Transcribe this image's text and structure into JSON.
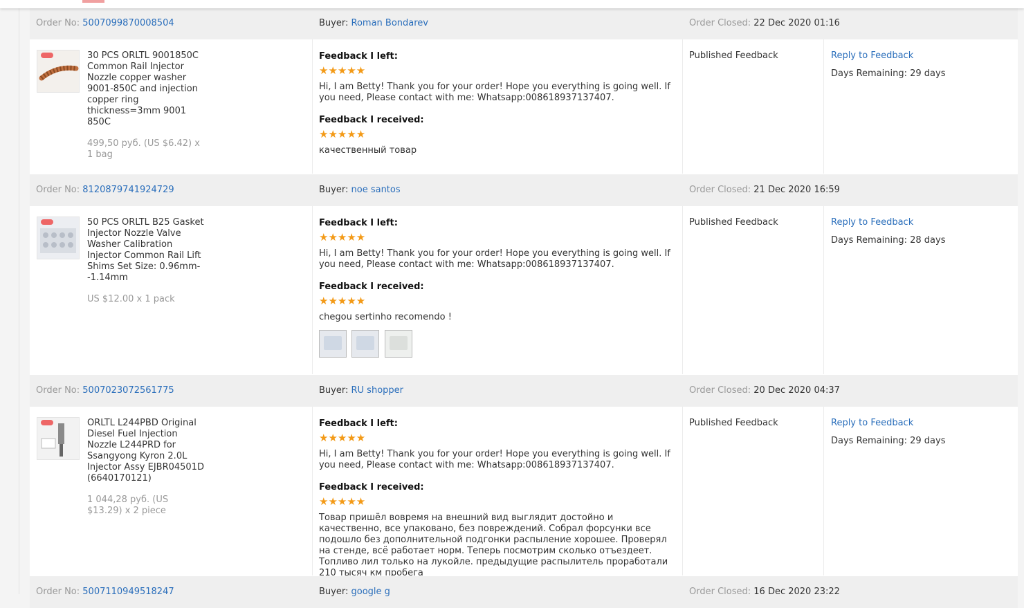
{
  "labels": {
    "order_no": "Order No:",
    "buyer": "Buyer:",
    "order_closed": "Order Closed:",
    "feedback_left": "Feedback I left:",
    "feedback_received": "Feedback I received:",
    "published": "Published Feedback",
    "reply": "Reply to Feedback"
  },
  "colors": {
    "link": "#2a6ebb",
    "star": "#f39a17",
    "header_bg": "#efefef"
  },
  "orders": [
    {
      "order_no": "5007099870008504",
      "buyer": "Roman Bondarev",
      "closed": "22 Dec 2020 01:16",
      "product_name": "30 PCS ORLTL 9001850C Common Rail Injector Nozzle copper washer 9001-850C and injection copper ring thickness=3mm 9001 850C",
      "price": "499,50 руб. (US $6.42) x 1 bag",
      "stars_left": "★★★★★",
      "feedback_left": "Hi, I am Betty! Thank you for your order! Hope you everything is going well. If you need, Please contact with me: Whatsapp:008618937137407.",
      "stars_received": "★★★★★",
      "feedback_received": "качественный товар",
      "days_remaining": "Days Remaining: 29 days"
    },
    {
      "order_no": "8120879741924729",
      "buyer": "noe santos",
      "closed": "21 Dec 2020 16:59",
      "product_name": "50 PCS ORLTL B25 Gasket Injector Nozzle Valve Washer Calibration Injector Common Rail Lift Shims Set Size: 0.96mm--1.14mm",
      "price": "US $12.00 x 1 pack",
      "stars_left": "★★★★★",
      "feedback_left": "Hi, I am Betty! Thank you for your order! Hope you everything is going well. If you need, Please contact with me: Whatsapp:008618937137407.",
      "stars_received": "★★★★★",
      "feedback_received": "chegou sertinho recomendo !",
      "days_remaining": "Days Remaining: 28 days"
    },
    {
      "order_no": "5007023072561775",
      "buyer": "RU shopper",
      "closed": "20 Dec 2020 04:37",
      "product_name": "ORLTL L244PBD Original Diesel Fuel Injection Nozzle L244PRD for Ssangyong Kyron 2.0L Injector Assy EJBR04501D (6640170121)",
      "price": "1 044,28 руб. (US $13.29) x 2 piece",
      "stars_left": "★★★★★",
      "feedback_left": "Hi, I am Betty! Thank you for your order! Hope you everything is going well. If you need, Please contact with me: Whatsapp:008618937137407.",
      "stars_received": "★★★★★",
      "feedback_received": "Товар пришёл вовремя на внешний вид выглядит достойно и качественно, все упаковано, без повреждений. Собрал форсунки все подошло без дополнительной подгонки распыление хорошее. Проверял на стенде, всё работает норм. Теперь посмотрим сколько отъездеет. Топливо лил только на лукойле. предыдущие распылитель проработали 210 тысяч км пробега",
      "days_remaining": "Days Remaining: 29 days"
    },
    {
      "order_no": "5007110949518247",
      "buyer": "google g",
      "closed": "16 Dec 2020 23:22"
    }
  ]
}
